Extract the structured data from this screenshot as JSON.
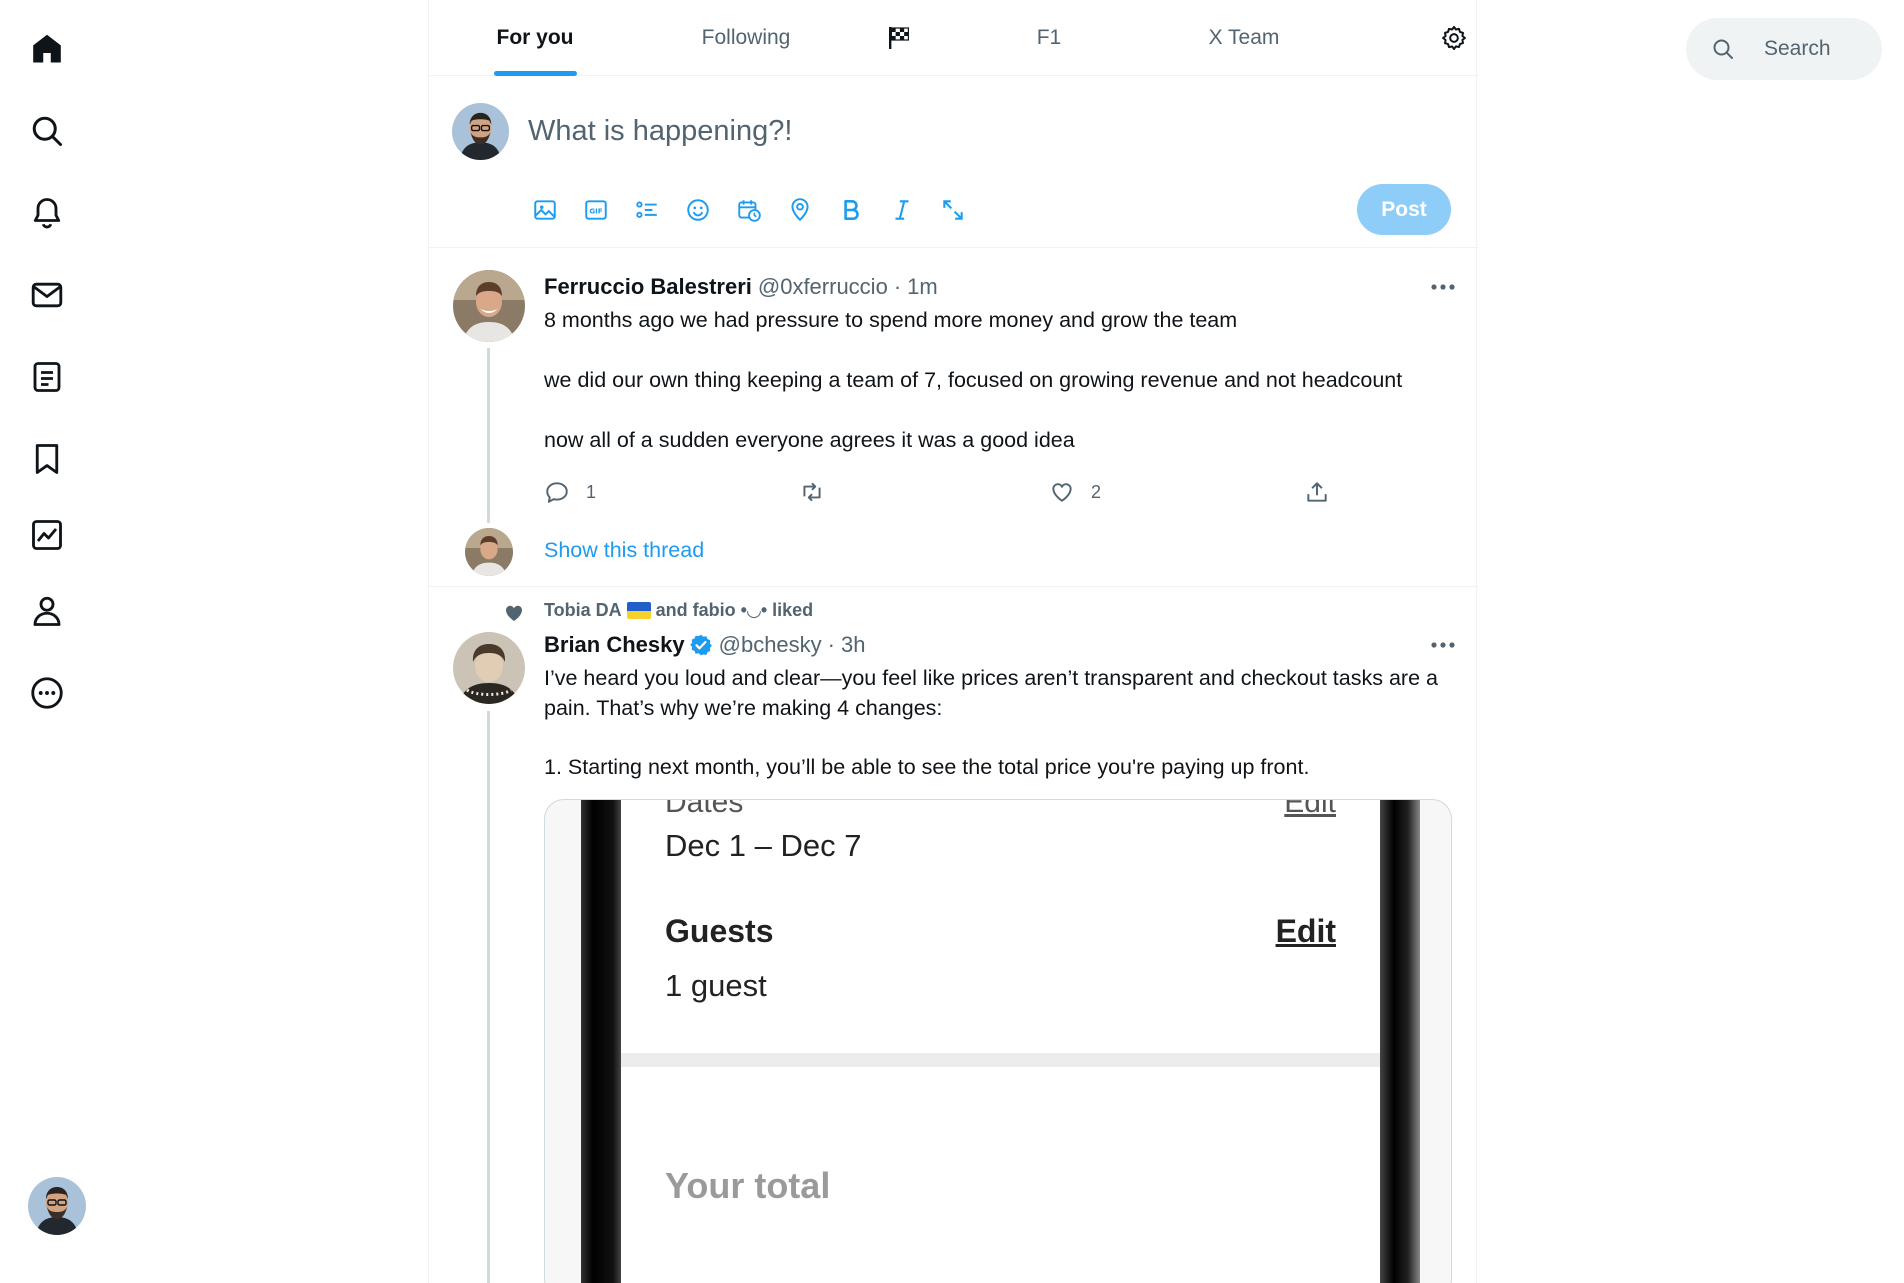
{
  "nav": {
    "items": [
      {
        "name": "home-icon"
      },
      {
        "name": "search-icon"
      },
      {
        "name": "bell-icon"
      },
      {
        "name": "mail-icon"
      },
      {
        "name": "list-icon"
      },
      {
        "name": "bookmark-icon"
      },
      {
        "name": "analytics-icon"
      },
      {
        "name": "profile-icon"
      },
      {
        "name": "more-circle-icon"
      }
    ]
  },
  "tabs": [
    {
      "label": "For you",
      "active": true
    },
    {
      "label": "Following",
      "active": false
    },
    {
      "label": "",
      "icon": "checkered-flag-icon",
      "active": false
    },
    {
      "label": "F1",
      "active": false
    },
    {
      "label": "X Team",
      "active": false
    }
  ],
  "composer": {
    "placeholder": "What is happening?!",
    "post_label": "Post",
    "tools": [
      "image-icon",
      "gif-icon",
      "poll-icon",
      "emoji-icon",
      "schedule-icon",
      "location-icon",
      "bold-icon",
      "italic-icon",
      "expand-icon"
    ]
  },
  "tweets": [
    {
      "name": "Ferruccio Balestreri",
      "handle": "@0xferruccio",
      "dot": "·",
      "time": "1m",
      "paragraphs": [
        "8 months ago we had pressure to spend more money and grow the team",
        "we did our own thing keeping a team of 7, focused on growing revenue and not headcount",
        "now all of a sudden everyone agrees it was a good idea"
      ],
      "replies": "1",
      "reposts": "",
      "likes": "2",
      "show_thread": "Show this thread"
    },
    {
      "social_context_a": "Tobia DA",
      "social_context_b": "and fabio •◡• liked",
      "name": "Brian Chesky",
      "verified": true,
      "handle": "@bchesky",
      "dot": "·",
      "time": "3h",
      "paragraphs": [
        "I’ve heard you loud and clear—you feel like prices aren’t transparent and checkout tasks are a pain. That’s why we’re making 4 changes:",
        "1. Starting next month, you’ll be able to see the total price you're paying up front."
      ],
      "media": {
        "cut_label": "Dates",
        "cut_edit": "Edit",
        "dates": "Dec 1 – Dec 7",
        "guests_label": "Guests",
        "guests_edit": "Edit",
        "guests_value": "1 guest",
        "total_label": "Your total"
      }
    }
  ],
  "search": {
    "placeholder": "Search"
  },
  "colors": {
    "accent": "#1d9bf0",
    "post_disabled": "#8ecdf8",
    "secondary_text": "#536471",
    "verified": "#1d9bf0"
  }
}
